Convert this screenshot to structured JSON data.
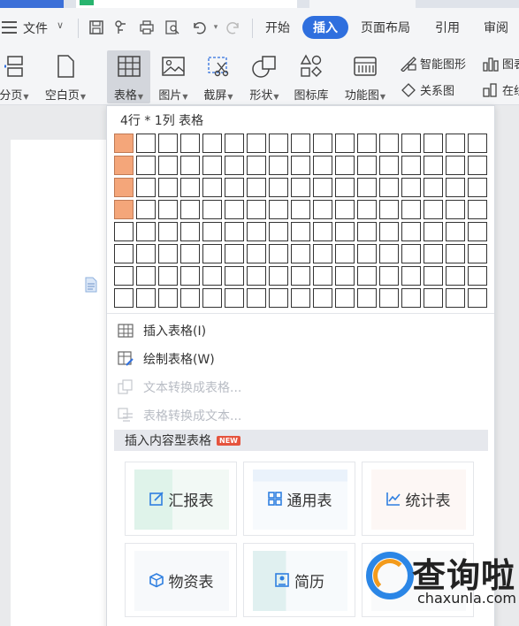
{
  "menubar": {
    "file_label": "文件",
    "tabs": [
      {
        "label": "开始",
        "active": false
      },
      {
        "label": "插入",
        "active": true
      },
      {
        "label": "页面布局",
        "active": false
      },
      {
        "label": "引用",
        "active": false
      },
      {
        "label": "审阅",
        "active": false
      }
    ]
  },
  "ribbon": {
    "page_break": "分页",
    "blank_page": "空白页",
    "table": "表格",
    "picture": "图片",
    "screenshot": "截屏",
    "shape": "形状",
    "icon_library": "图标库",
    "function_chart": "功能图",
    "smart_art": "智能图形",
    "relation_chart": "关系图",
    "chart_partial": "图表",
    "online_partial": "在线"
  },
  "dropdown": {
    "title": "4行 * 1列 表格",
    "grid": {
      "rows": 8,
      "cols": 17,
      "selected_rows": 4,
      "selected_cols": 1
    },
    "items": [
      {
        "label": "插入表格(I)",
        "enabled": true
      },
      {
        "label": "绘制表格(W)",
        "enabled": true
      },
      {
        "label": "文本转换成表格...",
        "enabled": false
      },
      {
        "label": "表格转换成文本...",
        "enabled": false
      }
    ],
    "section_title": "插入内容型表格",
    "new_badge": "NEW",
    "cards": [
      {
        "label": "汇报表"
      },
      {
        "label": "通用表"
      },
      {
        "label": "统计表"
      },
      {
        "label": "物资表"
      },
      {
        "label": "简历"
      }
    ]
  },
  "watermark": {
    "brand": "查询啦",
    "url": "chaxunla.com"
  },
  "colors": {
    "accent": "#2f6fde",
    "grid_selected": "#f4a67a",
    "badge": "#e5533d"
  }
}
